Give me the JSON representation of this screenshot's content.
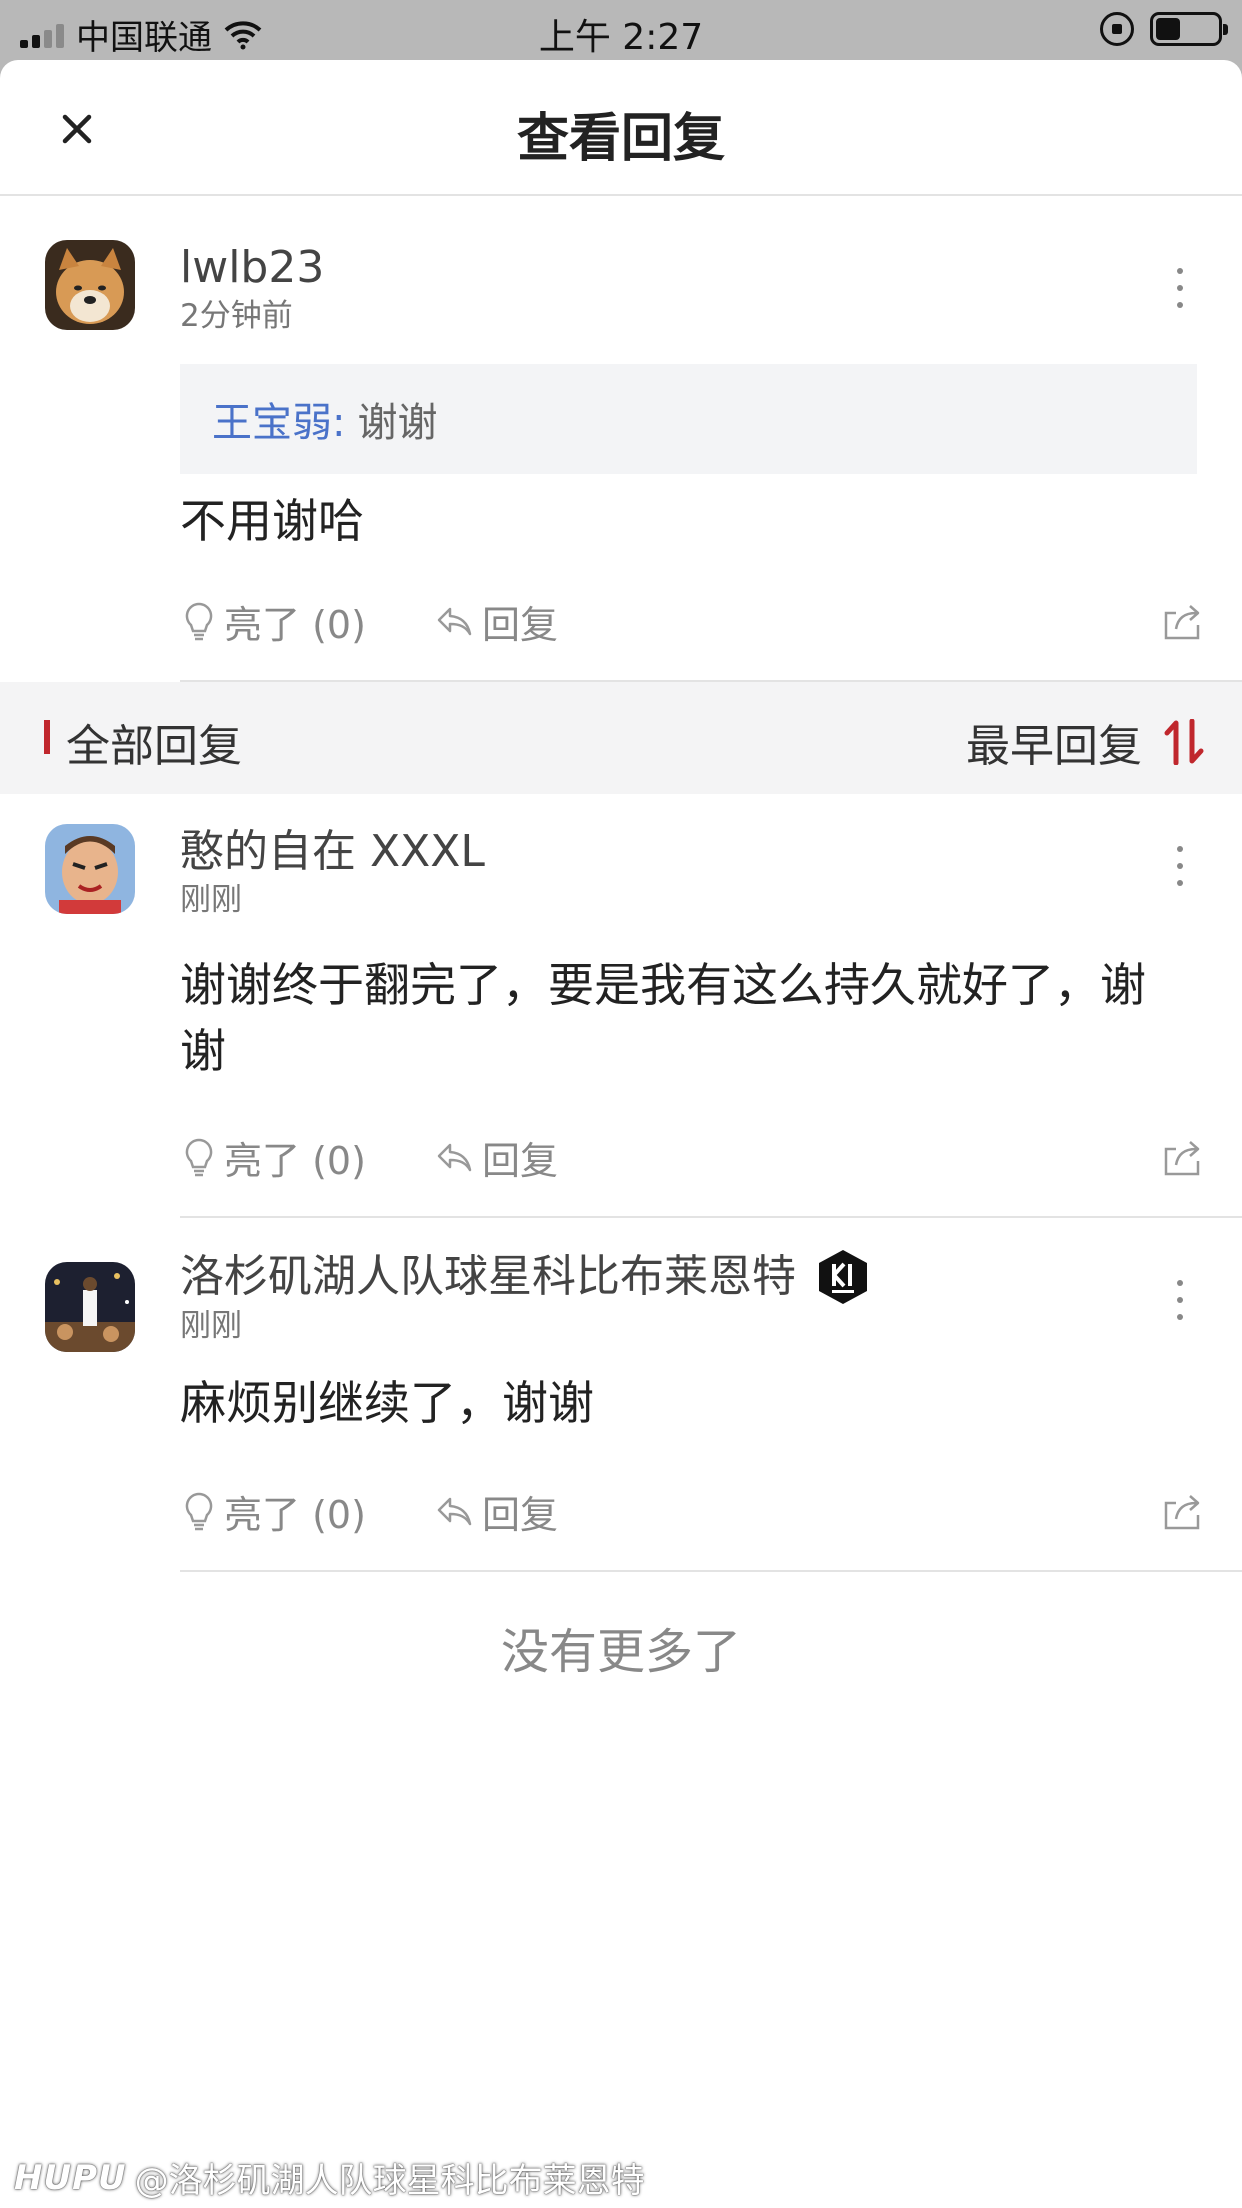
{
  "status_bar": {
    "carrier": "中国联通",
    "time": "上午 2:27"
  },
  "header": {
    "title": "查看回复"
  },
  "main_comment": {
    "username": "lwlb23",
    "time": "2分钟前",
    "quote_name": "王宝弱:",
    "quote_text": "谢谢",
    "text": "不用谢哈",
    "like_label": "亮了 (0)",
    "reply_label": "回复"
  },
  "section": {
    "title": "全部回复",
    "sort_label": "最早回复"
  },
  "replies": [
    {
      "username": "憨的自在 XXXL",
      "time": "刚刚",
      "text": "谢谢终于翻完了，要是我有这么持久就好了，谢谢",
      "like_label": "亮了 (0)",
      "reply_label": "回复"
    },
    {
      "username": "洛杉矶湖人队球星科比布莱恩特",
      "time": "刚刚",
      "text": "麻烦别继续了，谢谢",
      "like_label": "亮了 (0)",
      "reply_label": "回复"
    }
  ],
  "end_note": "没有更多了",
  "watermark": {
    "logo": "HUPU",
    "text": "@洛杉矶湖人队球星科比布莱恩特"
  },
  "colors": {
    "accent": "#c0272d",
    "link": "#4a72c9"
  }
}
